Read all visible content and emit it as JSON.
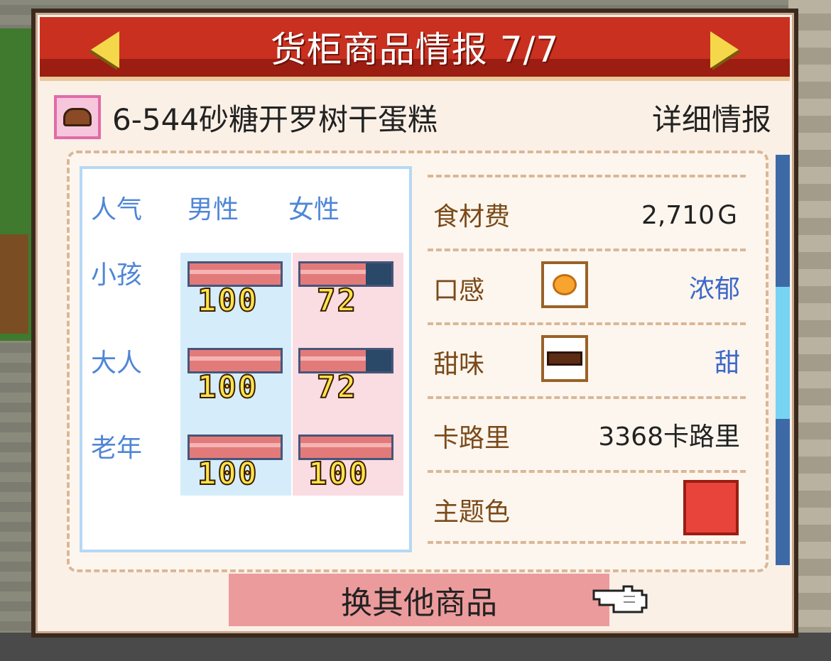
{
  "header": {
    "title": "货柜商品情报 7/7"
  },
  "item": {
    "name": "6-544砂糖开罗树干蛋糕",
    "detail_link": "详细情报"
  },
  "popularity": {
    "header_label": "人气",
    "col_male": "男性",
    "col_female": "女性",
    "rows": [
      {
        "label": "小孩",
        "male": 100,
        "female": 72
      },
      {
        "label": "大人",
        "male": 100,
        "female": 72
      },
      {
        "label": "老年",
        "male": 100,
        "female": 100
      }
    ]
  },
  "stats": {
    "cost_label": "食材费",
    "cost_value": "2,710Ｇ",
    "texture_label": "口感",
    "texture_value": "浓郁",
    "texture_icon": "soft-dough-icon",
    "sweet_label": "甜味",
    "sweet_value": "甜",
    "sweet_icon": "chocolate-bar-icon",
    "calorie_label": "卡路里",
    "calorie_value": "3368卡路里",
    "theme_label": "主题色",
    "theme_color": "#e8443c"
  },
  "footer": {
    "switch_label": "换其他商品",
    "pointer_icon": "pointing-hand-icon"
  },
  "colors": {
    "title_bar": "#c9301f",
    "bar_fill": "#e37a7a",
    "bar_empty": "#2a4868"
  }
}
